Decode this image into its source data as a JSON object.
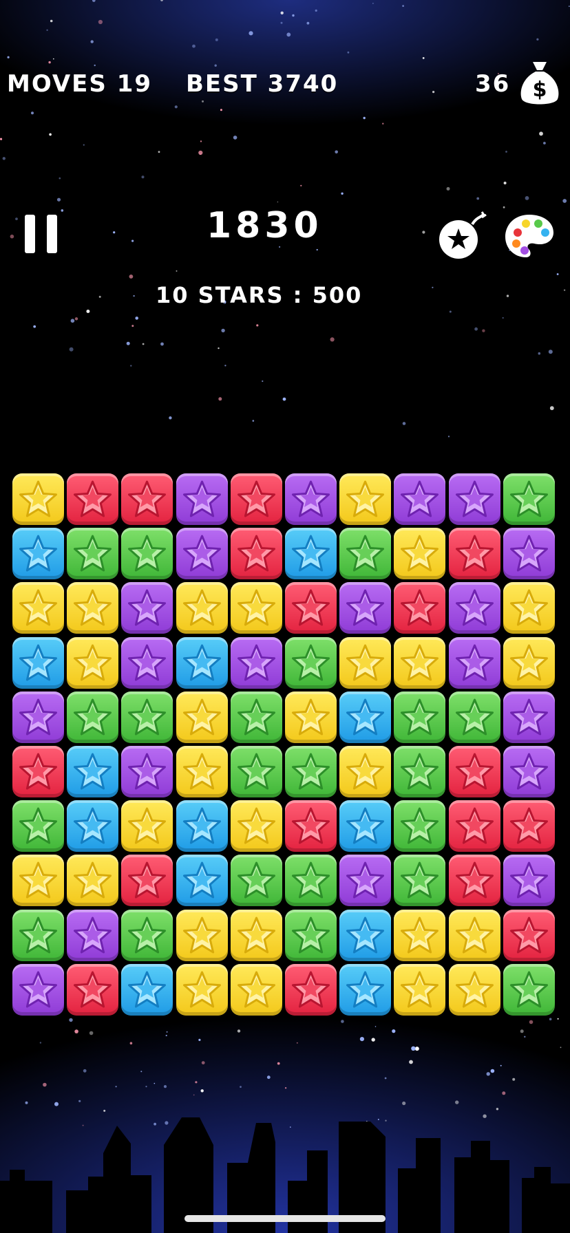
{
  "hud": {
    "moves_text": "MOVES 19",
    "best_text": "BEST 3740",
    "coins": "36",
    "score": "1830",
    "bonus_text": "10 STARS : 500"
  },
  "icons": {
    "coin_bag": "money-bag-icon",
    "pause": "pause-icon",
    "bomb": "star-bomb-icon",
    "palette": "paint-palette-icon"
  },
  "colors": {
    "yellow": "#f7d52a",
    "red": "#ee3a55",
    "purple": "#a34fe3",
    "green": "#58c94a",
    "blue": "#34b2f0"
  },
  "board": {
    "rows": 10,
    "cols": 10,
    "grid": [
      [
        "yellow",
        "red",
        "red",
        "purple",
        "red",
        "purple",
        "yellow",
        "purple",
        "purple",
        "green"
      ],
      [
        "blue",
        "green",
        "green",
        "purple",
        "red",
        "blue",
        "green",
        "yellow",
        "red",
        "purple"
      ],
      [
        "yellow",
        "yellow",
        "purple",
        "yellow",
        "yellow",
        "red",
        "purple",
        "red",
        "purple",
        "yellow"
      ],
      [
        "blue",
        "yellow",
        "purple",
        "blue",
        "purple",
        "green",
        "yellow",
        "yellow",
        "purple",
        "yellow"
      ],
      [
        "purple",
        "green",
        "green",
        "yellow",
        "green",
        "yellow",
        "blue",
        "green",
        "green",
        "purple"
      ],
      [
        "red",
        "blue",
        "purple",
        "yellow",
        "green",
        "green",
        "yellow",
        "green",
        "red",
        "purple"
      ],
      [
        "green",
        "blue",
        "yellow",
        "blue",
        "yellow",
        "red",
        "blue",
        "green",
        "red",
        "red"
      ],
      [
        "yellow",
        "yellow",
        "red",
        "blue",
        "green",
        "green",
        "purple",
        "green",
        "red",
        "purple"
      ],
      [
        "green",
        "purple",
        "green",
        "yellow",
        "yellow",
        "green",
        "blue",
        "yellow",
        "yellow",
        "red"
      ],
      [
        "purple",
        "red",
        "blue",
        "yellow",
        "yellow",
        "red",
        "blue",
        "yellow",
        "yellow",
        "green"
      ]
    ]
  }
}
